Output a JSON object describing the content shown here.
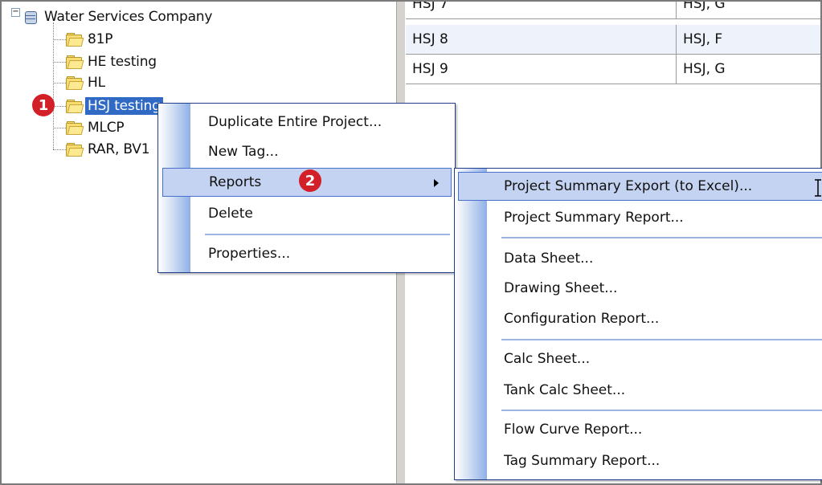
{
  "tree": {
    "root": "Water Services Company",
    "items": [
      "81P",
      "HE testing",
      "HL",
      "HSJ testing",
      "MLCP",
      "RAR, BV1"
    ]
  },
  "table": {
    "rows": [
      [
        "HSJ 7",
        "HSJ, G"
      ],
      [
        "HSJ 8",
        "HSJ, F"
      ],
      [
        "HSJ 9",
        "HSJ, G"
      ]
    ]
  },
  "badges": [
    "1",
    "2"
  ],
  "context_menu": {
    "items": [
      "Duplicate Entire Project...",
      "New Tag...",
      "Reports",
      "Delete",
      "Properties..."
    ]
  },
  "reports_submenu": {
    "items": [
      "Project Summary Export (to Excel)...",
      "Project Summary Report...",
      "Data Sheet...",
      "Drawing Sheet...",
      "Configuration Report...",
      "Calc Sheet...",
      "Tank Calc Sheet...",
      "Flow Curve Report...",
      "Tag Summary Report..."
    ]
  },
  "colors": {
    "selection": "#316ac5",
    "menu_highlight": "#c4d3f1",
    "badge": "#d31f27"
  }
}
